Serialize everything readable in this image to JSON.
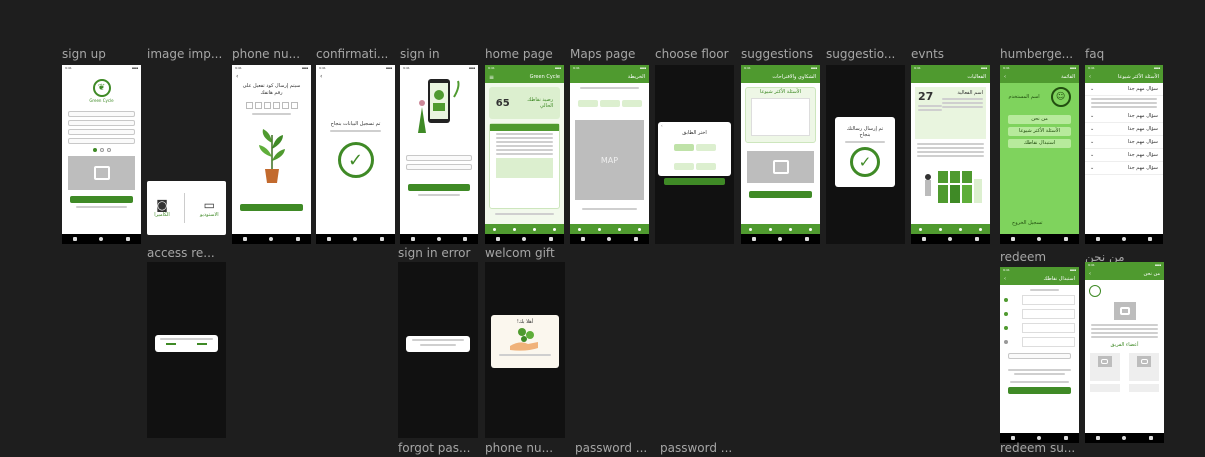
{
  "frame_labels": {
    "sign_up": "sign up",
    "image_import": "image imp...",
    "phone_number": "phone nu...",
    "confirmation": "confirmati...",
    "sign_in": "sign in",
    "home_page": "home page",
    "maps_page": "Maps page",
    "choose_floor": "choose floor",
    "suggestions": "suggestions",
    "suggestions2": "suggestio...",
    "events": "evnts",
    "hamburger": "humberge...",
    "faq": "faq",
    "access_request": "access re...",
    "sign_in_error": "sign in error",
    "welcome_gift": "welcom gift",
    "redeem": "redeem",
    "about_us": "من نحن",
    "forgot_password": "forgot pas...",
    "phone_number2": "phone nu...",
    "password1": "password ...",
    "password2": "password ...",
    "redeem_success": "redeem su..."
  },
  "sign_up": {
    "app_name": "Green Cycle"
  },
  "image_import": {
    "camera_label": "الكاميرا",
    "gallery_label": "الاستوديو"
  },
  "phone": {
    "title": "سيتم إرسال كود تفعيل على رقم هاتفك"
  },
  "confirmation": {
    "message": "تم تسجيل البيانات بنجاح"
  },
  "home": {
    "app_name": "Green Cycle",
    "points": "65",
    "balance_label": "رصيد نقاطك الحالي"
  },
  "maps": {
    "title": "الخريطة",
    "map_label": "MAP"
  },
  "choose_floor": {
    "title": "اختر الطابق"
  },
  "suggestions": {
    "header": "الشكاوي والاقتراحات",
    "faq_btn": "الأسئلة الأكثر شيوعا"
  },
  "suggestions2": {
    "message": "تم إرسال رسالتك بنجاح"
  },
  "events": {
    "header": "الفعاليات",
    "day": "27",
    "event_title": "اسم الفعالية"
  },
  "hamburger": {
    "header": "القائمة",
    "user_name": "اسم المستخدم",
    "items": [
      "من نحن",
      "الأسئلة الأكثر شيوعا",
      "استبدال نقاطك"
    ],
    "logout": "تسجيل الخروج"
  },
  "faq": {
    "header": "الأسئلة الأكثر شيوعا",
    "questions": [
      "سؤال مهم جدا",
      "سؤال مهم جدا",
      "سؤال مهم جدا",
      "سؤال مهم جدا",
      "سؤال مهم جدا",
      "سؤال مهم جدا"
    ]
  },
  "welcome_gift": {
    "title": "أهلا بك!"
  },
  "redeem": {
    "header": "استبدال نقاطك"
  },
  "about": {
    "header": "من نحن",
    "team_title": "أعضاء الفريق"
  },
  "colors": {
    "canvas": "#1e1e1e",
    "brand_green": "#4f9a2f",
    "dark_green": "#3f8a26",
    "light_green": "#e9f5df",
    "label_gray": "#a6a6a6"
  }
}
